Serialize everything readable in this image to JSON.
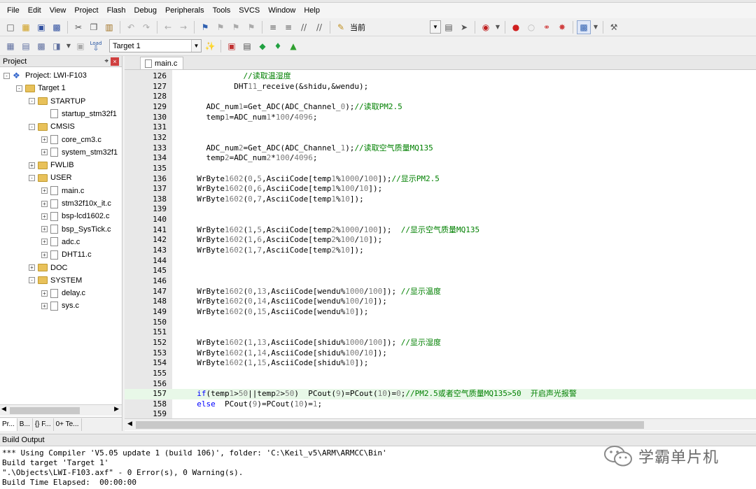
{
  "menu": [
    "File",
    "Edit",
    "View",
    "Project",
    "Flash",
    "Debug",
    "Peripherals",
    "Tools",
    "SVCS",
    "Window",
    "Help"
  ],
  "toolbar1": {
    "find_combo": "当前"
  },
  "toolbar2": {
    "target_combo": "Target 1",
    "load_label": "Load"
  },
  "project_panel": {
    "title": "Project",
    "tree": [
      {
        "level": 0,
        "kind": "project",
        "label": "Project: LWI-F103",
        "exp": "-"
      },
      {
        "level": 1,
        "kind": "folder",
        "label": "Target 1",
        "exp": "-"
      },
      {
        "level": 2,
        "kind": "folder",
        "label": "STARTUP",
        "exp": "-"
      },
      {
        "level": 3,
        "kind": "file",
        "label": "startup_stm32f1",
        "exp": ""
      },
      {
        "level": 2,
        "kind": "folder",
        "label": "CMSIS",
        "exp": "-"
      },
      {
        "level": 3,
        "kind": "file",
        "label": "core_cm3.c",
        "exp": "+"
      },
      {
        "level": 3,
        "kind": "file",
        "label": "system_stm32f1",
        "exp": "+"
      },
      {
        "level": 2,
        "kind": "folder",
        "label": "FWLIB",
        "exp": "+"
      },
      {
        "level": 2,
        "kind": "folder",
        "label": "USER",
        "exp": "-"
      },
      {
        "level": 3,
        "kind": "file",
        "label": "main.c",
        "exp": "+"
      },
      {
        "level": 3,
        "kind": "file",
        "label": "stm32f10x_it.c",
        "exp": "+"
      },
      {
        "level": 3,
        "kind": "file",
        "label": "bsp-lcd1602.c",
        "exp": "+"
      },
      {
        "level": 3,
        "kind": "file",
        "label": "bsp_SysTick.c",
        "exp": "+"
      },
      {
        "level": 3,
        "kind": "file",
        "label": "adc.c",
        "exp": "+"
      },
      {
        "level": 3,
        "kind": "file",
        "label": "DHT11.c",
        "exp": "+"
      },
      {
        "level": 2,
        "kind": "folder",
        "label": "DOC",
        "exp": "+"
      },
      {
        "level": 2,
        "kind": "folder",
        "label": "SYSTEM",
        "exp": "-"
      },
      {
        "level": 3,
        "kind": "file",
        "label": "delay.c",
        "exp": "+"
      },
      {
        "level": 3,
        "kind": "file",
        "label": "sys.c",
        "exp": "+"
      }
    ],
    "tabs": [
      "Pr...",
      "B...",
      "{} F...",
      "0+ Te..."
    ]
  },
  "editor": {
    "tab": "main.c",
    "lines": [
      {
        "n": "126",
        "text": "            //读取温湿度"
      },
      {
        "n": "127",
        "text": "          DHT11_receive(&shidu,&wendu);"
      },
      {
        "n": "128",
        "text": ""
      },
      {
        "n": "129",
        "text": "    ADC_num1=Get_ADC(ADC_Channel_0);//读取PM2.5"
      },
      {
        "n": "130",
        "text": "    temp1=ADC_num1*100/4096;"
      },
      {
        "n": "131",
        "text": ""
      },
      {
        "n": "132",
        "text": ""
      },
      {
        "n": "133",
        "text": "    ADC_num2=Get_ADC(ADC_Channel_1);//读取空气质量MQ135"
      },
      {
        "n": "134",
        "text": "    temp2=ADC_num2*100/4096;"
      },
      {
        "n": "135",
        "text": ""
      },
      {
        "n": "136",
        "text": "  WrByte1602(0,5,AsciiCode[temp1%1000/100]);//显示PM2.5"
      },
      {
        "n": "137",
        "text": "  WrByte1602(0,6,AsciiCode[temp1%100/10]);"
      },
      {
        "n": "138",
        "text": "  WrByte1602(0,7,AsciiCode[temp1%10]);"
      },
      {
        "n": "139",
        "text": ""
      },
      {
        "n": "140",
        "text": ""
      },
      {
        "n": "141",
        "text": "  WrByte1602(1,5,AsciiCode[temp2%1000/100]);  //显示空气质量MQ135"
      },
      {
        "n": "142",
        "text": "  WrByte1602(1,6,AsciiCode[temp2%100/10]);"
      },
      {
        "n": "143",
        "text": "  WrByte1602(1,7,AsciiCode[temp2%10]);"
      },
      {
        "n": "144",
        "text": ""
      },
      {
        "n": "145",
        "text": ""
      },
      {
        "n": "146",
        "text": ""
      },
      {
        "n": "147",
        "text": "  WrByte1602(0,13,AsciiCode[wendu%1000/100]); //显示温度"
      },
      {
        "n": "148",
        "text": "  WrByte1602(0,14,AsciiCode[wendu%100/10]);"
      },
      {
        "n": "149",
        "text": "  WrByte1602(0,15,AsciiCode[wendu%10]);"
      },
      {
        "n": "150",
        "text": ""
      },
      {
        "n": "151",
        "text": ""
      },
      {
        "n": "152",
        "text": "  WrByte1602(1,13,AsciiCode[shidu%1000/100]); //显示湿度"
      },
      {
        "n": "153",
        "text": "  WrByte1602(1,14,AsciiCode[shidu%100/10]);"
      },
      {
        "n": "154",
        "text": "  WrByte1602(1,15,AsciiCode[shidu%10]);"
      },
      {
        "n": "155",
        "text": ""
      },
      {
        "n": "156",
        "text": ""
      },
      {
        "n": "157",
        "text": "  if(temp1>50||temp2>50)  PCout(9)=PCout(10)=0;//PM2.5或者空气质量MQ135>50  开启声光报警"
      },
      {
        "n": "158",
        "text": "  else  PCout(9)=PCout(10)=1;"
      },
      {
        "n": "159",
        "text": ""
      }
    ],
    "highlight_line": "157"
  },
  "build_output": {
    "title": "Build Output",
    "lines": [
      "*** Using Compiler 'V5.05 update 1 (build 106)', folder: 'C:\\Keil_v5\\ARM\\ARMCC\\Bin'",
      "Build target 'Target 1'",
      "\".\\Objects\\LWI-F103.axf\" - 0 Error(s), 0 Warning(s).",
      "Build Time Elapsed:  00:00:00"
    ]
  },
  "watermark": {
    "text": "学霸单片机"
  },
  "colors": {
    "comment": "#008000",
    "keyword": "#0000ff",
    "line_highlight": "#e8f8e8"
  }
}
